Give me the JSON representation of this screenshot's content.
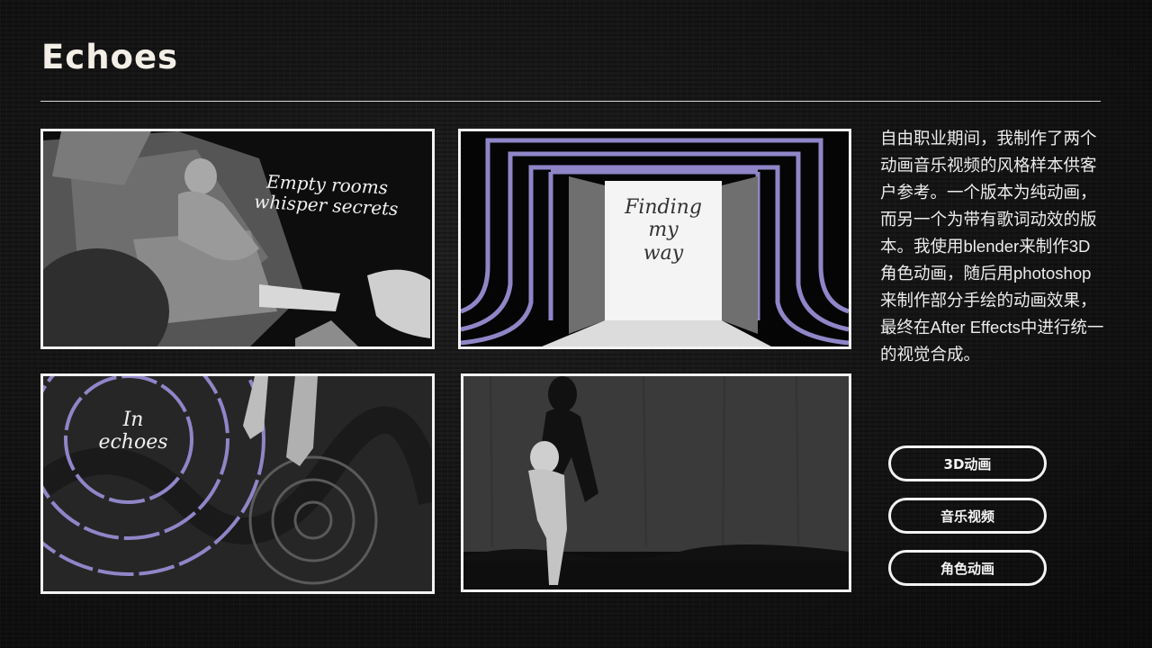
{
  "page": {
    "title": "Echoes"
  },
  "panels": [
    {
      "caption": "Empty rooms\nwhisper secrets"
    },
    {
      "caption": "Finding\nmy\nway"
    },
    {
      "caption": "In\nechoes"
    },
    {
      "caption": ""
    }
  ],
  "description": "自由职业期间，我制作了两个动画音乐视频的风格样本供客户参考。一个版本为纯动画，而另一个为带有歌词动效的版本。我使用blender来制作3D角色动画，随后用photoshop来制作部分手绘的动画效果，最终在After Effects中进行统一的视觉合成。",
  "tags": [
    "3D动画",
    "音乐视频",
    "角色动画"
  ],
  "colors": {
    "accent_purple": "#8f86c8",
    "background": "#141414",
    "frame": "#f2f2f2"
  }
}
